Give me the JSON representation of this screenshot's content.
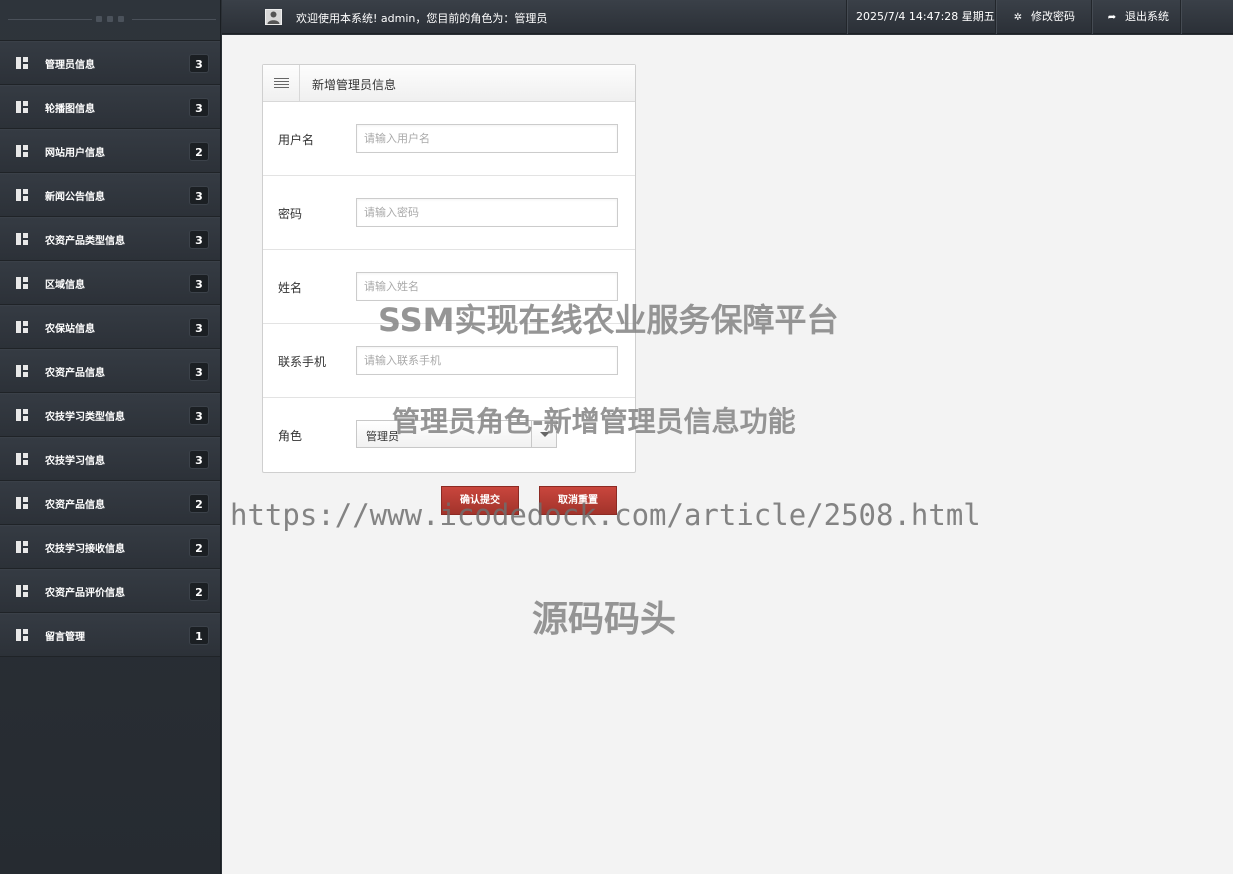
{
  "header": {
    "welcome_text": "欢迎使用本系统! admin，您目前的角色为：管理员",
    "datetime": "2025/7/4 14:47:28 星期五",
    "change_password": "修改密码",
    "logout": "退出系统"
  },
  "sidebar": {
    "items": [
      {
        "label": "管理员信息",
        "badge": "3"
      },
      {
        "label": "轮播图信息",
        "badge": "3"
      },
      {
        "label": "网站用户信息",
        "badge": "2"
      },
      {
        "label": "新闻公告信息",
        "badge": "3"
      },
      {
        "label": "农资产品类型信息",
        "badge": "3"
      },
      {
        "label": "区域信息",
        "badge": "3"
      },
      {
        "label": "农保站信息",
        "badge": "3"
      },
      {
        "label": "农资产品信息",
        "badge": "3"
      },
      {
        "label": "农技学习类型信息",
        "badge": "3"
      },
      {
        "label": "农技学习信息",
        "badge": "3"
      },
      {
        "label": "农资产品信息",
        "badge": "2"
      },
      {
        "label": "农技学习接收信息",
        "badge": "2"
      },
      {
        "label": "农资产品评价信息",
        "badge": "2"
      },
      {
        "label": "留言管理",
        "badge": "1"
      }
    ]
  },
  "form": {
    "title": "新增管理员信息",
    "fields": {
      "username": {
        "label": "用户名",
        "placeholder": "请输入用户名",
        "value": ""
      },
      "password": {
        "label": "密码",
        "placeholder": "请输入密码",
        "value": ""
      },
      "name": {
        "label": "姓名",
        "placeholder": "请输入姓名",
        "value": ""
      },
      "phone": {
        "label": "联系手机",
        "placeholder": "请输入联系手机",
        "value": ""
      },
      "role": {
        "label": "角色",
        "value": "管理员"
      }
    },
    "submit": "确认提交",
    "cancel": "取消重置"
  },
  "watermark": {
    "line1": "SSM实现在线农业服务保障平台",
    "line2": "管理员角色-新增管理员信息功能",
    "line3": "https://www.icodedock.com/article/2508.html",
    "line4": "源码码头"
  },
  "icons": {
    "menu_item": "grid-layout-icon",
    "user": "user-avatar-icon",
    "settings": "gear-icon",
    "logout": "share-arrow-icon",
    "panel": "list-lines-icon"
  },
  "colors": {
    "sidebar_bg": "#2e343b",
    "content_bg": "#f3f3f3",
    "button_red": "#b83b33"
  }
}
